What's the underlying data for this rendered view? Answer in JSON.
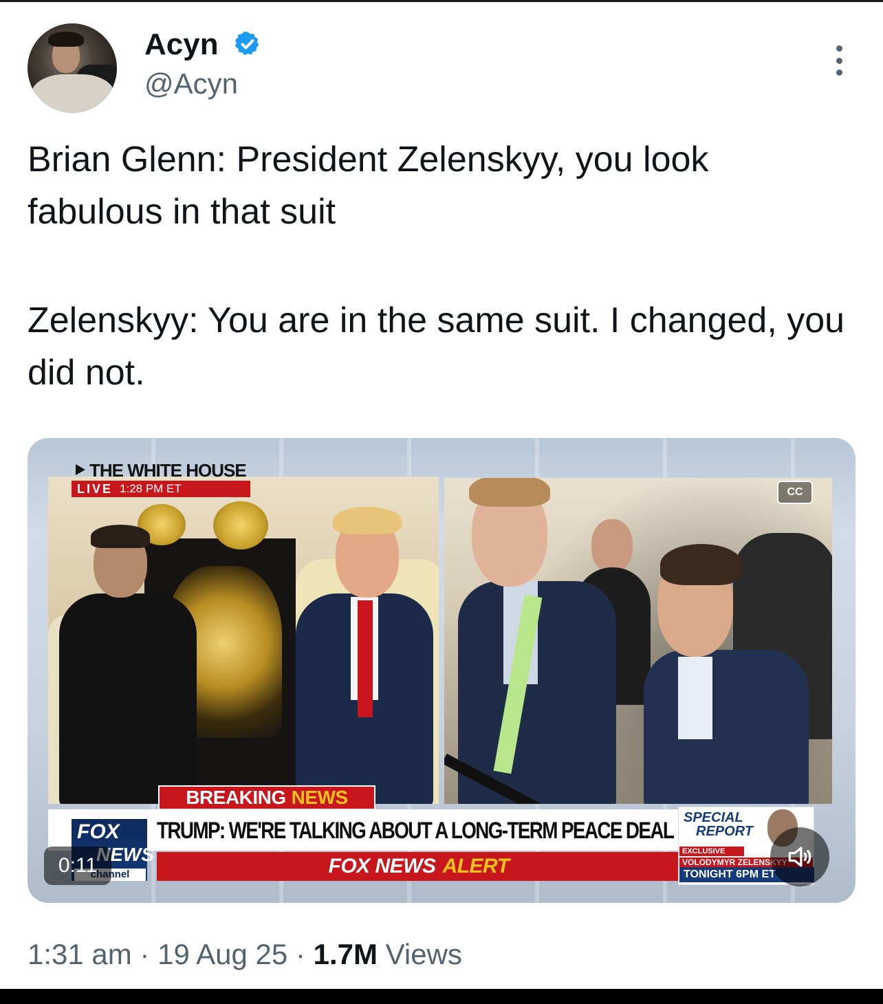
{
  "author": {
    "name": "Acyn",
    "handle": "@Acyn",
    "verified": true
  },
  "tweet": {
    "line1": "Brian Glenn: President Zelenskyy, you look fabulous in that suit",
    "line2": "Zelenskyy: You are in the same suit. I changed, you did not."
  },
  "video": {
    "location": "THE WHITE HOUSE",
    "live_label": "LIVE",
    "live_time": "1:28 PM ET",
    "breaking": "BREAKING",
    "breaking_news": "NEWS",
    "headline": "TRUMP: WE'RE TALKING ABOUT A LONG-TERM PEACE DEAL",
    "alert_prefix": "FOX NEWS",
    "alert_word": "ALERT",
    "logo_fox": "FOX",
    "logo_news": "NEWS",
    "logo_channel": "channel",
    "special_line1": "SPECIAL",
    "special_line2": "REPORT",
    "exclusive": "EXCLUSIVE",
    "promo_name": "VOLODYMYR ZELENSKYY",
    "promo_time": "TONIGHT 6PM ET",
    "cc_label": "CC",
    "timer": "0:11"
  },
  "meta": {
    "time": "1:31 am",
    "separator": " · ",
    "date": "19 Aug 25",
    "views_count": "1.7M",
    "views_label": " Views"
  },
  "colors": {
    "verified_blue": "#1d9bf0",
    "fox_red": "#c8161d",
    "fox_yellow": "#f7c21b",
    "fox_navy": "#0d2a5c",
    "secondary_text": "#536471"
  },
  "icons": {
    "verified": "verified-badge-icon",
    "more": "more-options-icon",
    "mute": "speaker-icon"
  }
}
